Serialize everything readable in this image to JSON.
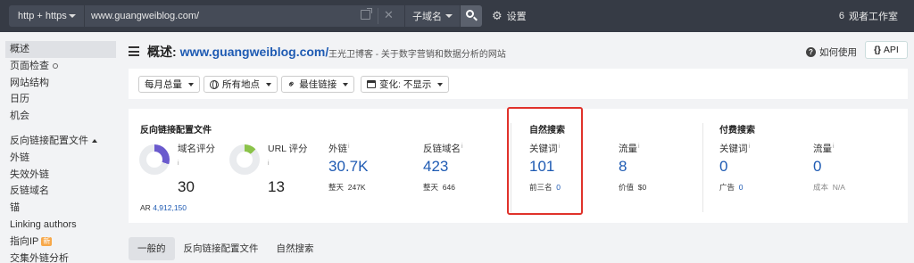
{
  "topbar": {
    "protocol": "http + https",
    "url": "www.guangweiblog.com/",
    "mode": "子域名",
    "settings": "设置",
    "observer": "观者工作室"
  },
  "sidebar": {
    "items_top": [
      "概述",
      "页面检查",
      "网站结构",
      "日历",
      "机会"
    ],
    "section_header": "反向链接配置文件",
    "items_bottom": [
      "外链",
      "失效外链",
      "反链域名",
      "锚",
      "Linking authors",
      "指向IP",
      "交集外链分析"
    ],
    "badge_new": "新"
  },
  "header": {
    "title_prefix": "概述: ",
    "title_url": "www.guangweiblog.com/",
    "subtitle": "王光卫博客 - 关于数字营销和数据分析的网站",
    "howto": "如何使用",
    "api": "API"
  },
  "filters": {
    "monthly": "每月总量",
    "locations": "所有地点",
    "best_links": "最佳链接",
    "change": "变化: 不显示"
  },
  "backlink_profile": {
    "title": "反向链接配置文件",
    "dr_label": "域名评分",
    "dr_value": "30",
    "dr_fill": 0.3,
    "ur_label": "URL 评分",
    "ur_value": "13",
    "ur_fill": 0.13,
    "ar_label": "AR",
    "ar_value": "4,912,150",
    "backlinks_label": "外链",
    "backlinks_value": "30.7K",
    "backlinks_sub_label": "整天",
    "backlinks_sub_value": "247K",
    "refdomains_label": "反链域名",
    "refdomains_value": "423",
    "refdomains_sub_label": "整天",
    "refdomains_sub_value": "646"
  },
  "organic": {
    "title": "自然搜索",
    "keywords_label": "关键词",
    "keywords_value": "101",
    "top3_label": "前三名",
    "top3_value": "0",
    "traffic_label": "流量",
    "traffic_value": "8",
    "value_label": "价值",
    "value_value": "$0"
  },
  "paid": {
    "title": "付费搜索",
    "keywords_label": "关键词",
    "keywords_value": "0",
    "ads_label": "广告",
    "ads_value": "0",
    "traffic_label": "流量",
    "traffic_value": "0",
    "cost_label": "成本",
    "cost_value": "N/A"
  },
  "tabs": [
    "一般的",
    "反向链接配置文件",
    "自然搜索"
  ],
  "colors": {
    "topbar_bg": "#363b45",
    "link_blue": "#1f5bb3",
    "dr_purple": "#6a5acd",
    "ur_green": "#8bc34a",
    "highlight_red": "#e0322b"
  }
}
